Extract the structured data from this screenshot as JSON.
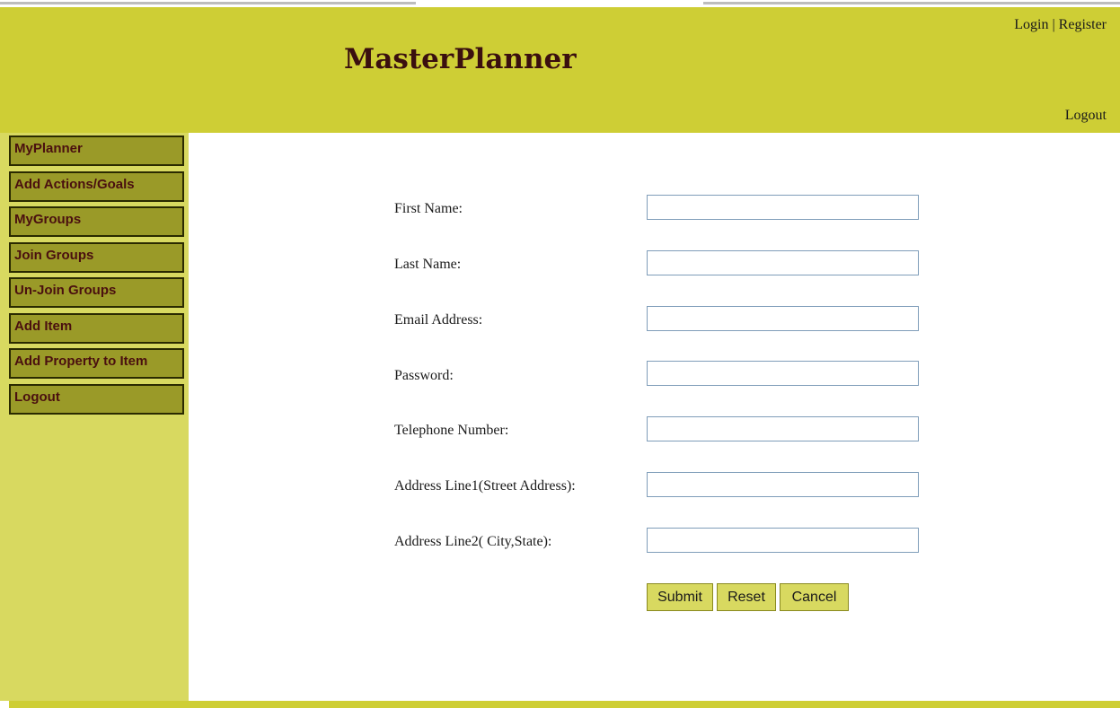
{
  "header": {
    "brand": "MasterPlanner",
    "nav": {
      "login": "Login",
      "separator": "|",
      "register": "Register",
      "logout": "Logout"
    }
  },
  "sidebar": {
    "items": [
      {
        "label": "MyPlanner"
      },
      {
        "label": "Add Actions/Goals"
      },
      {
        "label": "MyGroups"
      },
      {
        "label": "Join Groups"
      },
      {
        "label": "Un-Join Groups"
      },
      {
        "label": "Add Item"
      },
      {
        "label": "Add Property to Item"
      },
      {
        "label": "Logout"
      }
    ]
  },
  "form": {
    "fields": [
      {
        "label": "First Name:",
        "value": ""
      },
      {
        "label": "Last Name:",
        "value": ""
      },
      {
        "label": "Email Address:",
        "value": ""
      },
      {
        "label": "Password:",
        "value": ""
      },
      {
        "label": "Telephone Number:",
        "value": ""
      },
      {
        "label": "Address Line1(Street Address):",
        "value": ""
      },
      {
        "label": "Address Line2( City,State):",
        "value": ""
      }
    ],
    "buttons": {
      "submit": "Submit",
      "reset": "Reset",
      "cancel": "Cancel"
    }
  },
  "colors": {
    "header_bg": "#cece35",
    "sidebar_bg": "#d8d960",
    "menu_item_bg": "#9a9a28",
    "menu_text": "#4a0f0f",
    "brand_text": "#3a0f0f",
    "button_bg": "#d8d960"
  }
}
